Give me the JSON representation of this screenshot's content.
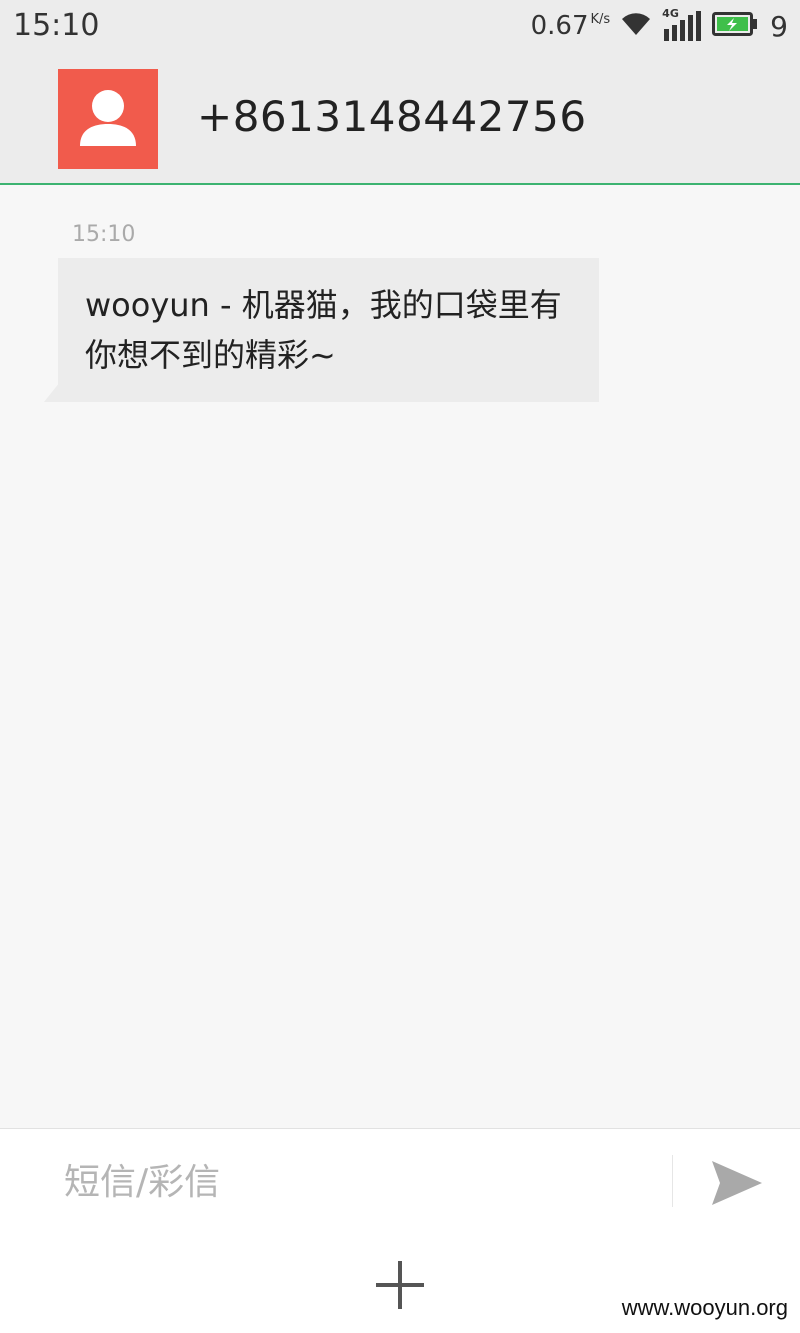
{
  "status_bar": {
    "time": "15:10",
    "net_speed": "0.67",
    "net_speed_unit": "K/s",
    "network_type": "4G",
    "battery_level": "9",
    "icons": [
      "wifi-icon",
      "signal-icon",
      "battery-charging-icon"
    ]
  },
  "header": {
    "contact_number": "+8613148442756",
    "avatar_color": "#f15b4c",
    "accent_color": "#3cb371"
  },
  "messages": [
    {
      "time": "15:10",
      "text": "wooyun - 机器猫，我的口袋里有你想不到的精彩~"
    }
  ],
  "compose": {
    "placeholder": "短信/彩信",
    "send_icon": "send-icon"
  },
  "bottom_bar": {
    "add_icon": "plus-icon"
  },
  "watermark": "www.wooyun.org"
}
